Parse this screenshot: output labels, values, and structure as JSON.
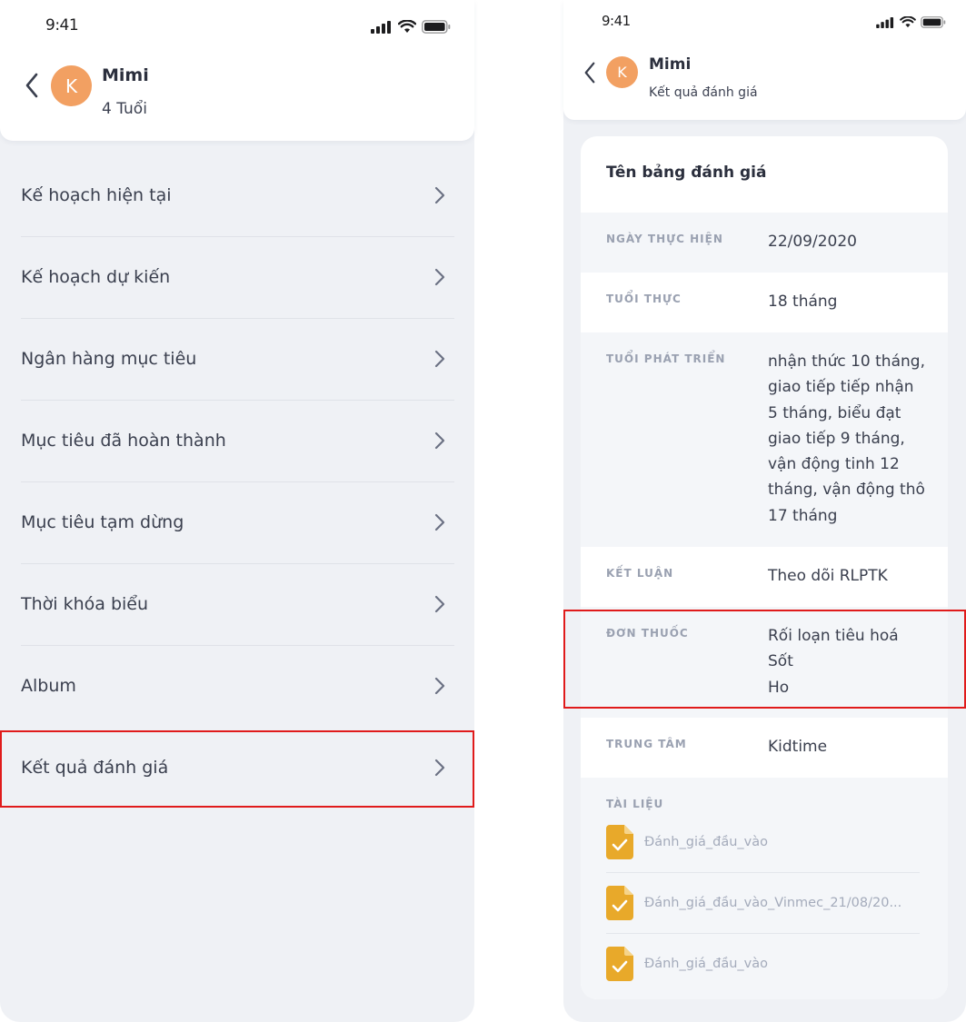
{
  "left": {
    "status": {
      "time": "9:41"
    },
    "header": {
      "avatar_letter": "K",
      "name": "Mimi",
      "age": "4 Tuổi"
    },
    "menu": [
      {
        "label": "Kế hoạch hiện tại"
      },
      {
        "label": "Kế hoạch dự kiến"
      },
      {
        "label": "Ngân hàng mục tiêu"
      },
      {
        "label": "Mục tiêu đã hoàn thành"
      },
      {
        "label": "Mục tiêu tạm dừng"
      },
      {
        "label": "Thời khóa biểu"
      },
      {
        "label": "Album"
      },
      {
        "label": "Kết quả đánh giá"
      }
    ]
  },
  "right": {
    "status": {
      "time": "9:41"
    },
    "header": {
      "avatar_letter": "K",
      "name": "Mimi",
      "subtitle": "Kết quả đánh giá"
    },
    "card": {
      "title": "Tên bảng đánh giá",
      "rows": [
        {
          "label": "NGÀY THỰC HIỆN",
          "value": "22/09/2020"
        },
        {
          "label": "TUỔI THỰC",
          "value": "18 tháng"
        },
        {
          "label": "TUỔI PHÁT TRIỂN",
          "value": "nhận thức 10 tháng, giao tiếp tiếp nhận 5 tháng, biểu đạt giao tiếp 9 tháng, vận động tinh 12 tháng, vận động thô 17 tháng"
        },
        {
          "label": "KẾT LUẬN",
          "value": "Theo dõi RLPTK"
        },
        {
          "label": "ĐƠN THUỐC",
          "lines": [
            "Rối loạn tiêu hoá",
            "Sốt",
            "Ho"
          ]
        },
        {
          "label": "TRUNG TÂM",
          "value": "Kidtime"
        }
      ],
      "documents_label": "TÀI LIỆU",
      "documents": [
        {
          "name": "Đánh_giá_đầu_vào"
        },
        {
          "name": "Đánh_giá_đầu_vào_Vinmec_21/08/20..."
        },
        {
          "name": "Đánh_giá_đầu_vào"
        }
      ]
    }
  },
  "colors": {
    "avatar": "#f2a062",
    "doc_icon": "#e8a92a",
    "highlight": "#e01b1b",
    "screen_bg": "#eff1f5"
  },
  "icons": {
    "back": "chevron-left-icon",
    "menu_chevron": "chevron-right-icon",
    "document": "document-check-icon",
    "status": [
      "signal-icon",
      "wifi-icon",
      "battery-icon"
    ]
  }
}
